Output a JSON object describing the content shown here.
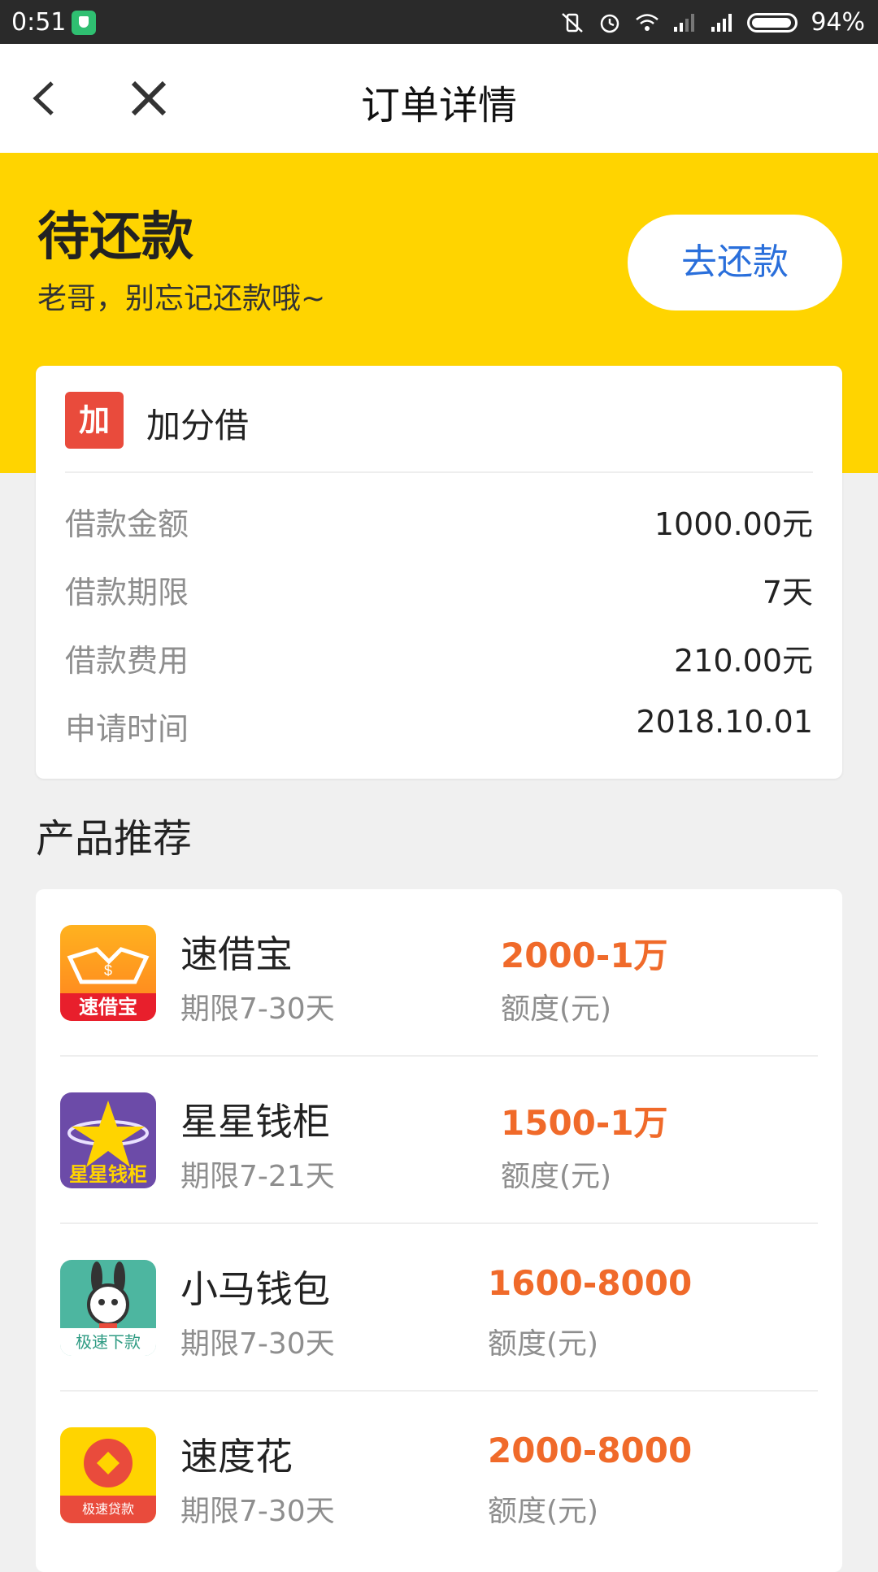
{
  "status_bar": {
    "time": "0:51",
    "battery": "94%"
  },
  "nav": {
    "title": "订单详情"
  },
  "hero": {
    "status": "待还款",
    "subtitle": "老哥，别忘记还款哦~",
    "repay_button": "去还款"
  },
  "order": {
    "brand_icon_text": "加",
    "brand_name": "加分借",
    "rows": [
      {
        "label": "借款金额",
        "value": "1000.00元"
      },
      {
        "label": "借款期限",
        "value": "7天"
      },
      {
        "label": "借款费用",
        "value": "210.00元"
      },
      {
        "label": "申请时间",
        "value": "2018.10.01"
      }
    ]
  },
  "recommend": {
    "title": "产品推荐",
    "items": [
      {
        "name": "速借宝",
        "term": "期限7-30天",
        "amount": "2000-1万",
        "amount_label": "额度(元)",
        "logo_text": "速借宝",
        "logo_colors": [
          "#ff9a1f",
          "#e81f2c"
        ]
      },
      {
        "name": "星星钱柜",
        "term": "期限7-21天",
        "amount": "1500-1万",
        "amount_label": "额度(元)",
        "logo_text": "星星钱柜",
        "logo_colors": [
          "#6c4ba8",
          "#ffd400"
        ]
      },
      {
        "name": "小马钱包",
        "term": "期限7-30天",
        "amount": "1600-8000",
        "amount_label": "额度(元)",
        "logo_text": "极速下款",
        "logo_colors": [
          "#4db6a0",
          "#e8f4f1"
        ]
      },
      {
        "name": "速度花",
        "term": "期限7-30天",
        "amount": "2000-8000",
        "amount_label": "额度(元)",
        "logo_text": "极速贷款",
        "logo_colors": [
          "#ffd400",
          "#e94b3c"
        ]
      }
    ]
  }
}
